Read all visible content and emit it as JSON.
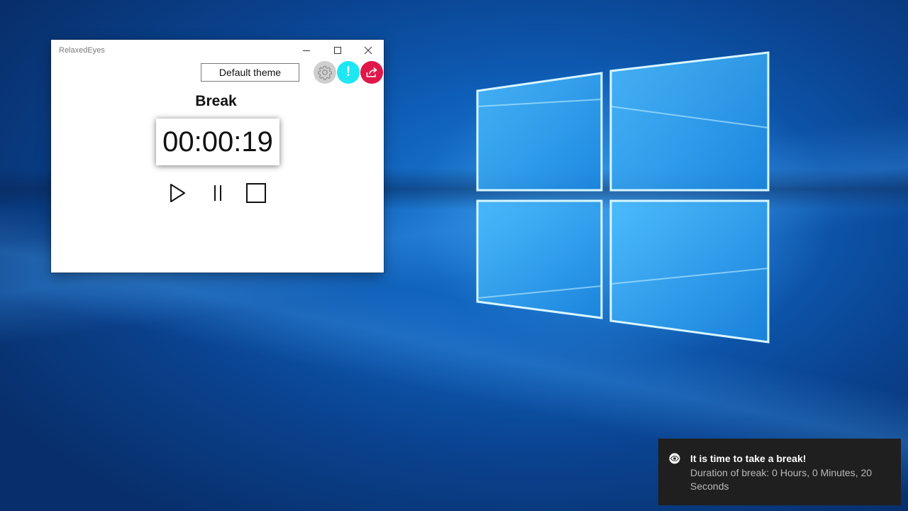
{
  "window": {
    "title": "RelaxedEyes",
    "theme_button_label": "Default theme",
    "info_button_glyph": "!",
    "icons": {
      "minimize": "minimize-icon",
      "maximize": "maximize-icon",
      "close": "close-icon",
      "settings": "gear-icon",
      "info": "info-icon",
      "share": "share-icon"
    },
    "colors": {
      "settings_button": "#cfcfcf",
      "info_button": "#1ee7f2",
      "share_button": "#e0174a"
    }
  },
  "timer": {
    "mode_label": "Break",
    "display": "00:00:19",
    "controls": [
      "play-icon",
      "pause-icon",
      "stop-icon"
    ]
  },
  "notification": {
    "icon": "eye-icon",
    "title": "It is time to take a break!",
    "body": "Duration of break: 0 Hours, 0 Minutes, 20 Seconds"
  }
}
